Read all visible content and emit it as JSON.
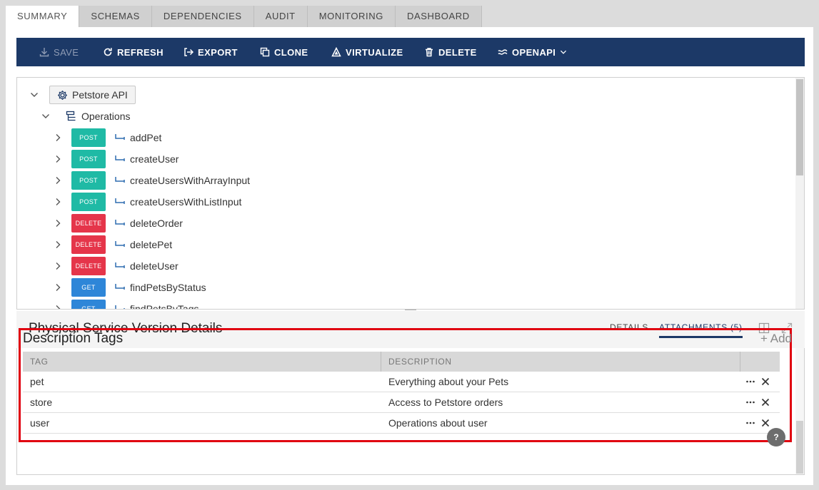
{
  "tabs": [
    "SUMMARY",
    "SCHEMAS",
    "DEPENDENCIES",
    "AUDIT",
    "MONITORING",
    "DASHBOARD"
  ],
  "toolbar": {
    "save": "SAVE",
    "refresh": "REFRESH",
    "export": "EXPORT",
    "clone": "CLONE",
    "virtualize": "VIRTUALIZE",
    "delete": "DELETE",
    "openapi": "OPENAPI"
  },
  "tree": {
    "root": "Petstore API",
    "group": "Operations",
    "operations": [
      {
        "method": "POST",
        "name": "addPet"
      },
      {
        "method": "POST",
        "name": "createUser"
      },
      {
        "method": "POST",
        "name": "createUsersWithArrayInput"
      },
      {
        "method": "POST",
        "name": "createUsersWithListInput"
      },
      {
        "method": "DELETE",
        "name": "deleteOrder"
      },
      {
        "method": "DELETE",
        "name": "deletePet"
      },
      {
        "method": "DELETE",
        "name": "deleteUser"
      },
      {
        "method": "GET",
        "name": "findPetsByStatus"
      },
      {
        "method": "GET",
        "name": "findPetsByTags"
      }
    ]
  },
  "details": {
    "title": "Physical Service Version Details",
    "tab_details": "DETAILS",
    "tab_attachments": "ATTACHMENTS (5)"
  },
  "description_tags": {
    "title": "Description Tags",
    "add": "+ Add",
    "columns": [
      "TAG",
      "DESCRIPTION"
    ],
    "rows": [
      {
        "tag": "pet",
        "description": "Everything about your Pets"
      },
      {
        "tag": "store",
        "description": "Access to Petstore orders"
      },
      {
        "tag": "user",
        "description": "Operations about user"
      }
    ]
  },
  "help": "?",
  "colors": {
    "toolbar_bg": "#1c3967",
    "post": "#1fbaa5",
    "delete": "#e5354a",
    "get": "#2e86d8",
    "highlight": "#e0000f"
  }
}
